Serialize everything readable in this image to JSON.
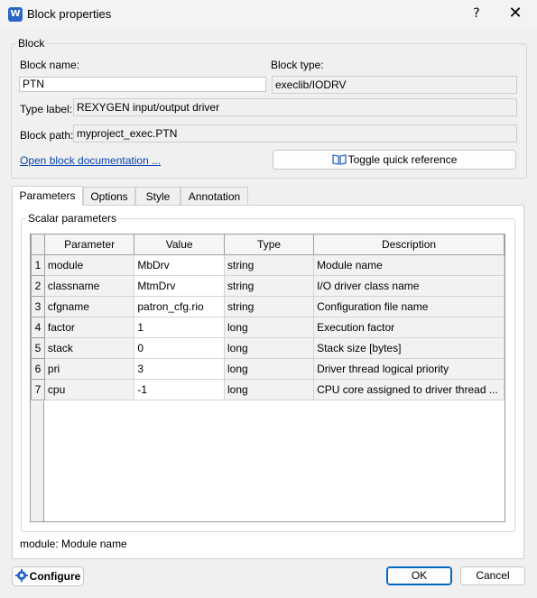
{
  "window": {
    "title": "Block properties",
    "help": "?",
    "close": "✕",
    "app_icon": "W"
  },
  "block_group": {
    "title": "Block",
    "name_label": "Block name:",
    "name_value": "PTN",
    "type_label": "Block type:",
    "type_value": "execlib/IODRV",
    "typelabel_label": "Type label:",
    "typelabel_value": "REXYGEN input/output driver",
    "path_label": "Block path:",
    "path_value": "myproject_exec.PTN",
    "doc_link": "Open block documentation ...",
    "quickref_button": "Toggle quick reference"
  },
  "tabs": [
    "Parameters",
    "Options",
    "Style",
    "Annotation"
  ],
  "scalar": {
    "title": "Scalar parameters",
    "columns": [
      "Parameter",
      "Value",
      "Type",
      "Description"
    ],
    "rows": [
      {
        "n": "1",
        "param": "module",
        "value": "MbDrv",
        "type": "string",
        "desc": "Module name"
      },
      {
        "n": "2",
        "param": "classname",
        "value": "MtmDrv",
        "type": "string",
        "desc": "I/O driver class name"
      },
      {
        "n": "3",
        "param": "cfgname",
        "value": "patron_cfg.rio",
        "type": "string",
        "desc": "Configuration file name"
      },
      {
        "n": "4",
        "param": "factor",
        "value": "1",
        "type": "long",
        "desc": "Execution factor"
      },
      {
        "n": "5",
        "param": "stack",
        "value": "0",
        "type": "long",
        "desc": "Stack size [bytes]"
      },
      {
        "n": "6",
        "param": "pri",
        "value": "3",
        "type": "long",
        "desc": "Driver thread logical priority"
      },
      {
        "n": "7",
        "param": "cpu",
        "value": "-1",
        "type": "long",
        "desc": "CPU core assigned to driver thread ..."
      }
    ]
  },
  "status_text": "module: Module name",
  "footer": {
    "configure": "Configure",
    "ok": "OK",
    "cancel": "Cancel"
  },
  "colors": {
    "accent": "#0067c0",
    "link": "#0645ad",
    "icon_blue": "#2b66c4"
  }
}
